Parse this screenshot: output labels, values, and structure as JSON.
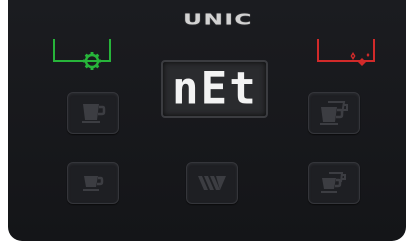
{
  "brand": {
    "logo_text": "UNIC"
  },
  "display": {
    "text": "nEt"
  },
  "colors": {
    "panel": "#1b1c20",
    "clean_indicator": "#27b43a",
    "descale_indicator": "#d22a2a",
    "button_icon": "#3c3d42",
    "display_text": "#f3f3f3"
  },
  "indicators": [
    {
      "name": "cleaning-indicator",
      "icon": "gear-icon",
      "color": "#27b43a"
    },
    {
      "name": "descaling-indicator",
      "icon": "sparkle-icon",
      "color": "#d22a2a"
    }
  ],
  "buttons": [
    {
      "name": "large-cup-button",
      "icon": "large-cup-icon"
    },
    {
      "name": "double-large-cup-button",
      "icon": "double-large-cup-icon"
    },
    {
      "name": "small-cup-button",
      "icon": "small-cup-icon"
    },
    {
      "name": "hot-water-button",
      "icon": "hot-water-icon"
    },
    {
      "name": "double-small-cup-button",
      "icon": "double-small-cup-icon"
    }
  ]
}
